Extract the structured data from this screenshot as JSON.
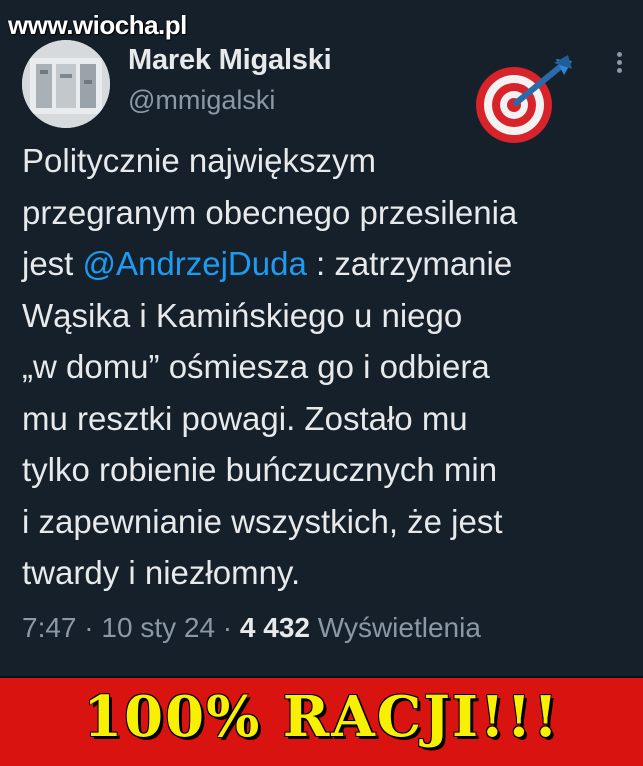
{
  "watermark": "www.wiocha.pl",
  "tweet": {
    "author_name": "Marek Migalski",
    "author_handle": "@mmigalski",
    "text_lines": [
      "Politycznie największym",
      "przegranym obecnego przesilenia"
    ],
    "line3_prefix": "jest ",
    "mention": "@AndrzejDuda",
    "line3_suffix": " : zatrzymanie",
    "text_lines_rest": [
      "Wąsika i Kamińskiego u niego",
      "„w domu” ośmiesza go i odbiera",
      "mu resztki powagi. Zostało mu",
      "tylko robienie buńczucznych min",
      "i zapewnianie wszystkich, że jest",
      "twardy i niezłomny."
    ],
    "time": "7:47",
    "separator": " · ",
    "date": "10 sty 24",
    "views_count": "4 432",
    "views_label": "Wyświetlenia"
  },
  "icons": {
    "avatar": "avatar-image",
    "more": "more-dots-icon",
    "target": "dart-target-icon"
  },
  "banner": {
    "text": "100% RACJI!!!"
  },
  "colors": {
    "tweet_bg": "#15202b",
    "text": "#e7e9ea",
    "muted": "#8b98a5",
    "mention": "#1d9bf0",
    "banner_bg": "#d9130f",
    "banner_text": "#f7f000"
  }
}
